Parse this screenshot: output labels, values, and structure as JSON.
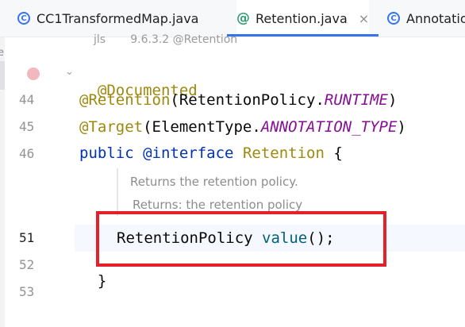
{
  "tabs": [
    {
      "label": "CC1TransformedMap.java",
      "icon": "class-icon",
      "active": false
    },
    {
      "label": "Retention.java",
      "icon": "annotation-icon",
      "active": true,
      "close": "×"
    },
    {
      "label": "Annotatio",
      "icon": "class-icon",
      "active": false
    }
  ],
  "left_strip_letter": "e",
  "inlay_hint": "jls       9.6.3.2 @Retention",
  "gutter": {
    "line_numbers": [
      "44",
      "45",
      "46",
      "51",
      "52",
      "53"
    ]
  },
  "code": {
    "line_documented": "@Documented",
    "line44": {
      "annotation": "@Retention",
      "open": "(",
      "type": "RetentionPolicy",
      "dot": ".",
      "constant": "RUNTIME",
      "close": ")"
    },
    "line45": {
      "annotation": "@Target",
      "open": "(",
      "type": "ElementType",
      "dot": ".",
      "constant": "ANNOTATION_TYPE",
      "close": ")"
    },
    "line46": {
      "kw_public": "public",
      "kw_interface": "@interface",
      "name": "Retention",
      "brace": "{"
    },
    "doc": {
      "line1": "Returns the retention policy.",
      "line2": "Returns: the retention policy"
    },
    "line51": {
      "type": "RetentionPolicy",
      "method": "value",
      "rest": "();"
    },
    "line52": "}"
  },
  "colors": {
    "highlight_box": "#e3202b",
    "accent": "#3574f0"
  }
}
